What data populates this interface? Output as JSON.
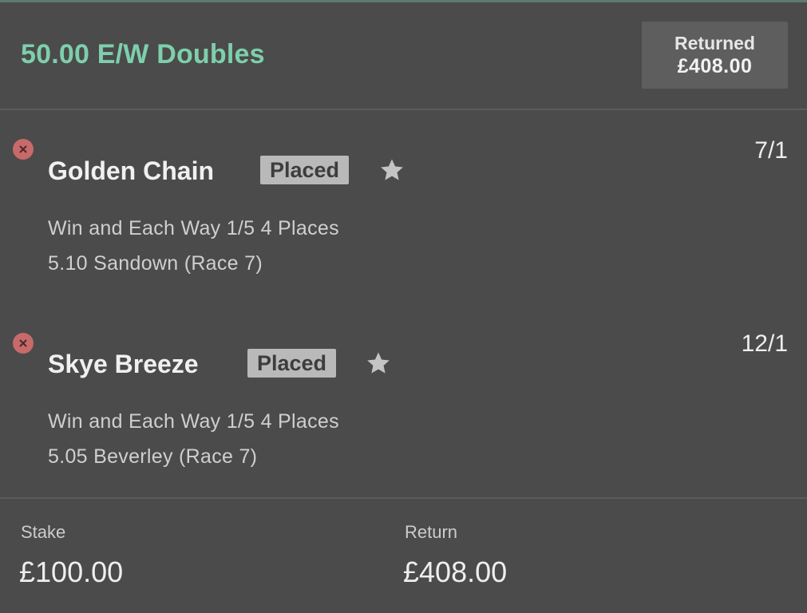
{
  "bet": {
    "title": "50.00 E/W Doubles",
    "returned_label": "Returned",
    "returned_amount": "£408.00"
  },
  "selections": [
    {
      "runner": "Golden Chain",
      "status": "Placed",
      "odds": "7/1",
      "market": "Win and Each Way 1/5 4 Places",
      "event": "5.10 Sandown (Race 7)",
      "icons": {
        "remove": "remove-x-icon",
        "favourite": "star-icon"
      }
    },
    {
      "runner": "Skye Breeze",
      "status": "Placed",
      "odds": "12/1",
      "market": "Win and Each Way 1/5 4 Places",
      "event": "5.05 Beverley (Race 7)",
      "icons": {
        "remove": "remove-x-icon",
        "favourite": "star-icon"
      }
    }
  ],
  "footer": {
    "stake_label": "Stake",
    "stake_value": "£100.00",
    "return_label": "Return",
    "return_value": "£408.00"
  },
  "colors": {
    "background": "#4b4b4b",
    "accent_green": "#7ecfad",
    "badge_bg": "#b9b9b9",
    "remove_red": "#c86a6a"
  }
}
